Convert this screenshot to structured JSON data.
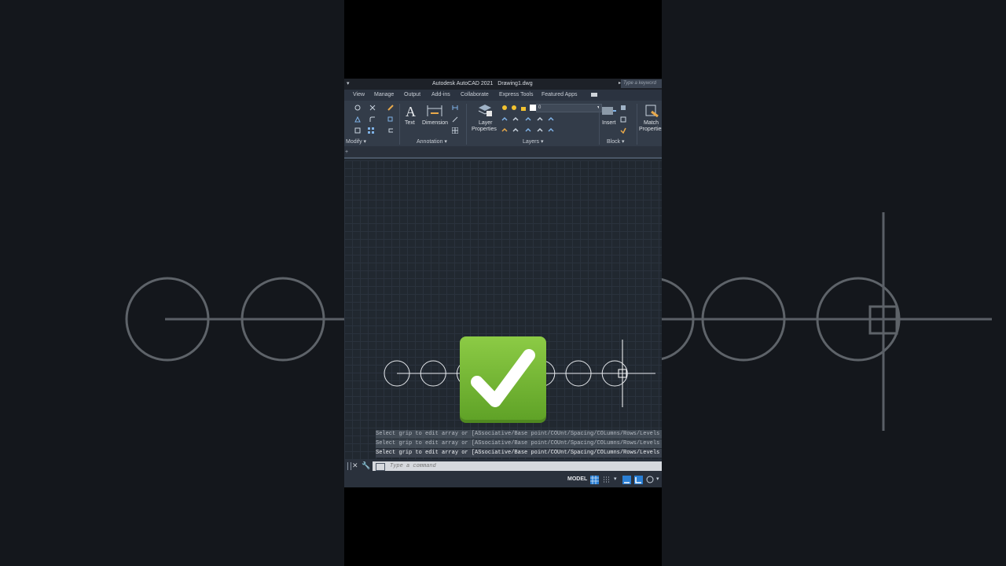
{
  "window": {
    "title": "Autodesk AutoCAD 2021   Drawing1.dwg",
    "search_placeholder": "Type a keyword"
  },
  "menu": [
    "View",
    "Manage",
    "Output",
    "Add-ins",
    "Collaborate",
    "Express Tools",
    "Featured Apps"
  ],
  "ribbon": {
    "text_label": "Text",
    "dimension_label": "Dimension",
    "layer_properties_label_1": "Layer",
    "layer_properties_label_2": "Properties",
    "layer_current": "0",
    "insert_label": "Insert",
    "match_label_1": "Match",
    "match_label_2": "Properties",
    "panels": {
      "modify": "Modify ▾",
      "annotation": "Annotation ▾",
      "layers": "Layers ▾",
      "block": "Block ▾"
    }
  },
  "command_history": [
    "Select grip to edit array or [ASsociative/Base point/COUnt/Spacing/COLumns/Rows/Levels",
    "Select grip to edit array or [ASsociative/Base point/COUnt/Spacing/COLumns/Rows/Levels",
    "Select grip to edit array or [ASsociative/Base point/COUnt/Spacing/COLumns/Rows/Levels"
  ],
  "command_placeholder": "Type a command",
  "status": {
    "model_label": "MODEL"
  },
  "drawing": {
    "circle_count": 7
  },
  "colors": {
    "accent_blue": "#2a7fd4",
    "check_green": "#78b83a"
  }
}
